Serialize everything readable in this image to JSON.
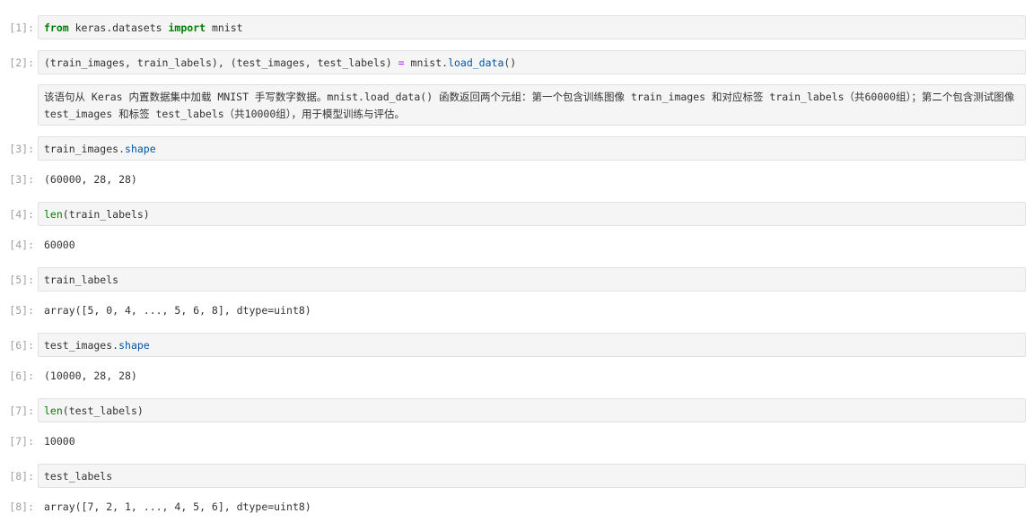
{
  "cells": [
    {
      "prompt": "[1]:",
      "kind": "input",
      "tokens": {
        "a": "from",
        "b": " keras.datasets ",
        "c": "import",
        "d": " mnist"
      }
    },
    {
      "prompt": "[2]:",
      "kind": "input",
      "tokens": {
        "a": "(train_images, train_labels), (test_images, test_labels) ",
        "b": "=",
        "c": " mnist.",
        "d": "load_data",
        "e": "()"
      }
    },
    {
      "kind": "markdown",
      "text": "该语句从 Keras 内置数据集中加载 MNIST 手写数字数据。mnist.load_data() 函数返回两个元组：第一个包含训练图像 train_images 和对应标签 train_labels（共60000组）；第二个包含测试图像 test_images 和标签 test_labels（共10000组），用于模型训练与评估。"
    },
    {
      "prompt": "[3]:",
      "kind": "input",
      "tokens": {
        "a": "train_images.",
        "b": "shape"
      }
    },
    {
      "prompt": "[3]:",
      "kind": "output",
      "text": "(60000, 28, 28)"
    },
    {
      "prompt": "[4]:",
      "kind": "input",
      "tokens": {
        "a": "len",
        "b": "(train_labels)"
      }
    },
    {
      "prompt": "[4]:",
      "kind": "output",
      "text": "60000"
    },
    {
      "prompt": "[5]:",
      "kind": "input",
      "tokens": {
        "a": "train_labels"
      }
    },
    {
      "prompt": "[5]:",
      "kind": "output",
      "text": "array([5, 0, 4, ..., 5, 6, 8], dtype=uint8)"
    },
    {
      "prompt": "[6]:",
      "kind": "input",
      "tokens": {
        "a": "test_images.",
        "b": "shape"
      }
    },
    {
      "prompt": "[6]:",
      "kind": "output",
      "text": "(10000, 28, 28)"
    },
    {
      "prompt": "[7]:",
      "kind": "input",
      "tokens": {
        "a": "len",
        "b": "(test_labels)"
      }
    },
    {
      "prompt": "[7]:",
      "kind": "output",
      "text": "10000"
    },
    {
      "prompt": "[8]:",
      "kind": "input",
      "tokens": {
        "a": "test_labels"
      }
    },
    {
      "prompt": "[8]:",
      "kind": "output",
      "text": "array([7, 2, 1, ..., 4, 5, 6], dtype=uint8)"
    }
  ],
  "colors": {
    "prompt": "#9e9e9e",
    "cell_bg": "#f5f5f5",
    "cell_border": "#e0e0e0",
    "keyword": "#008000",
    "function": "#0055aa",
    "operator": "#aa22ff",
    "text": "#333333"
  }
}
